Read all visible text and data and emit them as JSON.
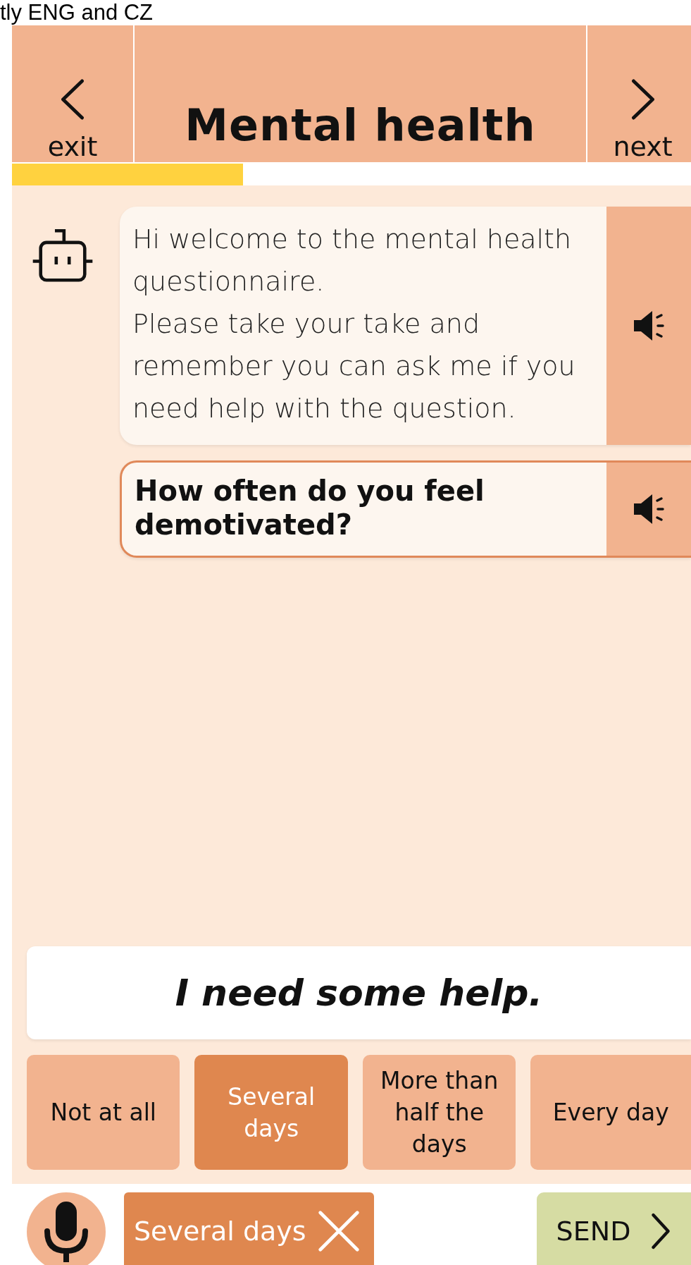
{
  "caption": "tly ENG and CZ",
  "header": {
    "back_label": "exit",
    "title": "Mental health",
    "next_label": "next"
  },
  "progress": {
    "level": 0.34
  },
  "messages": [
    {
      "kind": "bot",
      "text": "Hi welcome to the mental health questionnaire.\nPlease take your take and remember you can ask me if you need help with the question."
    },
    {
      "kind": "question",
      "text": "How often do you feel demotivated?"
    }
  ],
  "help_button": "I need some help.",
  "options": [
    {
      "label": "Not at all",
      "selected": false
    },
    {
      "label": "Several days",
      "selected": true
    },
    {
      "label": "More than half the days",
      "selected": false
    },
    {
      "label": "Every day",
      "selected": false
    }
  ],
  "answer_chip": {
    "label": "Several days"
  },
  "send_button": "SEND"
}
